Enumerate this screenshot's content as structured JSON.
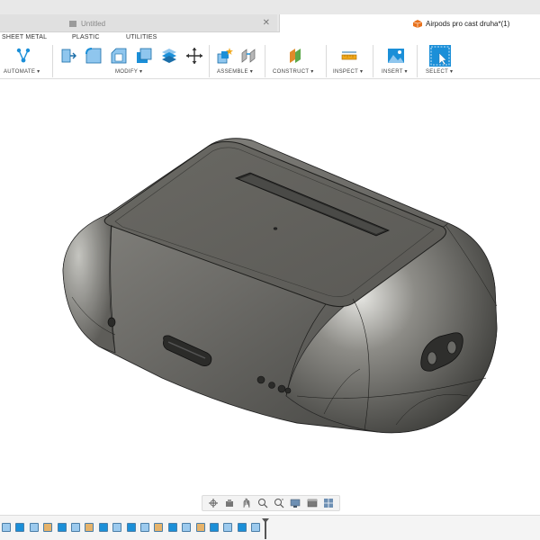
{
  "tabs": [
    {
      "label": "Untitled",
      "active": false
    },
    {
      "label": "Airpods pro cast druha*(1)",
      "active": true
    }
  ],
  "toolbar": {
    "subtabs": [
      "SHEET METAL",
      "PLASTIC",
      "UTILITIES"
    ],
    "groups": {
      "automate": "AUTOMATE ▾",
      "modify": "MODIFY ▾",
      "assemble": "ASSEMBLE ▾",
      "construct": "CONSTRUCT ▾",
      "inspect": "INSPECT ▾",
      "insert": "INSERT ▾",
      "select": "SELECT ▾"
    }
  },
  "colors": {
    "accent_blue": "#1b8fd8",
    "tab_icon_orange": "#e8711c",
    "model_body": "#6b6a66",
    "construct_orange": "#e08a2a",
    "construct_green": "#5ba84a"
  },
  "icons": {
    "automate": "automate-node-icon",
    "modify": [
      "press-pull-icon",
      "fillet-icon",
      "chamfer-icon",
      "shell-icon",
      "combine-icon",
      "move-icon"
    ],
    "assemble": [
      "new-component-icon",
      "joint-icon"
    ],
    "construct": "offset-plane-icon",
    "inspect": "measure-icon",
    "insert": "insert-image-icon",
    "select": "select-cursor-icon",
    "navbar": [
      "orbit-icon",
      "pan-icon",
      "look-at-icon",
      "zoom-icon",
      "fit-icon",
      "display-settings-icon",
      "visual-style-icon",
      "grid-icon"
    ]
  }
}
